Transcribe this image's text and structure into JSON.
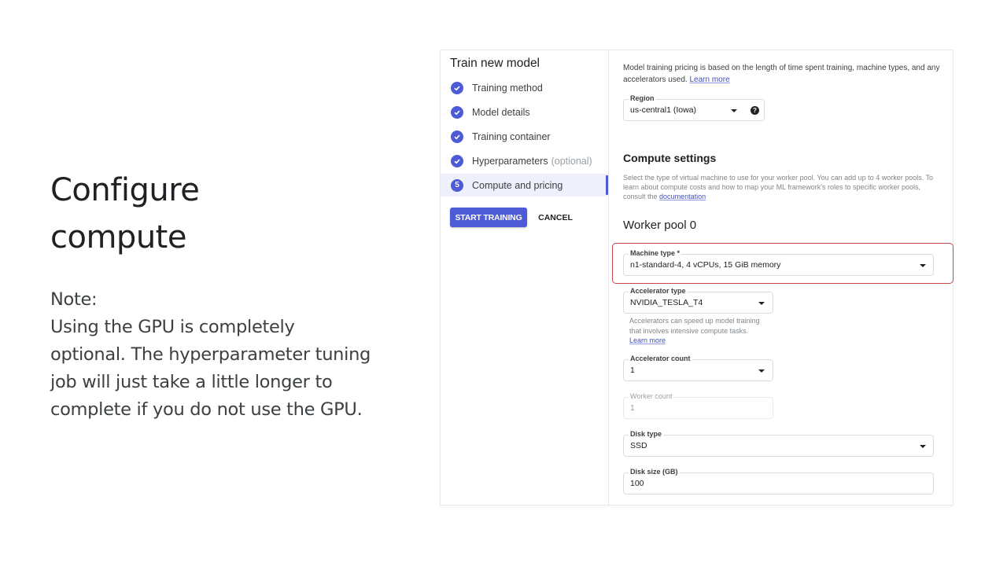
{
  "slide": {
    "title_lines": [
      "Configure",
      "compute"
    ],
    "note_lines": [
      "Note:",
      "Using the GPU is completely",
      "optional. The hyperparameter tuning",
      "job will just take a little longer to",
      "complete if you do not use the GPU."
    ]
  },
  "stepper": {
    "title": "Train new model",
    "steps": [
      {
        "label": "Training method",
        "status": "complete",
        "icon": "check-icon"
      },
      {
        "label": "Model details",
        "status": "complete",
        "icon": "check-icon"
      },
      {
        "label": "Training container",
        "status": "complete",
        "icon": "check-icon"
      },
      {
        "label": "Hyperparameters",
        "suffix": "(optional)",
        "status": "complete",
        "icon": "check-icon"
      },
      {
        "label": "Compute and pricing",
        "status": "active",
        "number": "5"
      }
    ],
    "start_button": "START TRAINING",
    "cancel_button": "CANCEL"
  },
  "content": {
    "intro_text": "Model training pricing is based on the length of time spent training, machine types, and any accelerators used.",
    "intro_link": "Learn more",
    "region": {
      "label": "Region",
      "value": "us-central1 (Iowa)",
      "help_icon": "?"
    },
    "compute_title": "Compute settings",
    "compute_desc": "Select the type of virtual machine to use for your worker pool. You can add up to 4 worker pools. To learn about compute costs and how to map your ML framework's roles to specific worker pools, consult the",
    "compute_link": "documentation",
    "worker_pool_title": "Worker pool 0",
    "machine_type": {
      "label": "Machine type *",
      "value": "n1-standard-4, 4 vCPUs, 15 GiB memory"
    },
    "accelerator_type": {
      "label": "Accelerator type",
      "value": "NVIDIA_TESLA_T4"
    },
    "accelerator_help": "Accelerators can speed up model training that involves intensive compute tasks.",
    "accelerator_link": "Learn more",
    "accelerator_count": {
      "label": "Accelerator count",
      "value": "1"
    },
    "worker_count": {
      "label": "Worker count",
      "value": "1"
    },
    "disk_type": {
      "label": "Disk type",
      "value": "SSD"
    },
    "disk_size": {
      "label": "Disk size (GB)",
      "value": "100"
    }
  },
  "colors": {
    "accent": "#4d5bd6",
    "highlight_border": "#c5474a",
    "link": "#3f51b5"
  }
}
